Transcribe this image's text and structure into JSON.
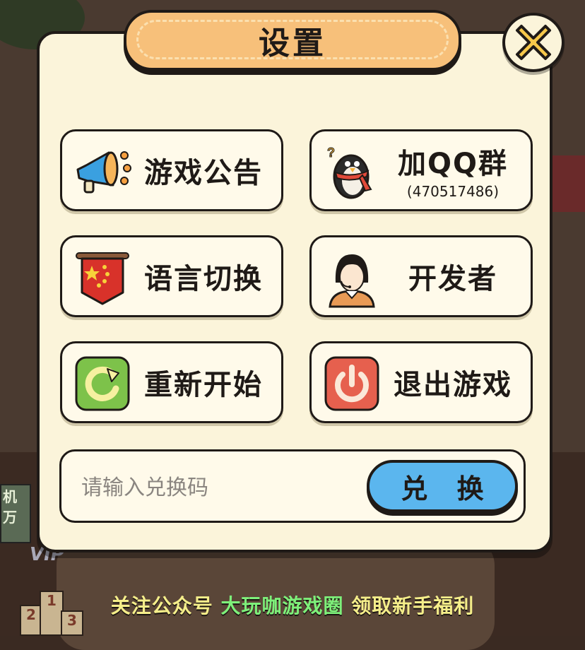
{
  "dialog": {
    "title": "设置",
    "close_icon": "close-x-icon"
  },
  "options": [
    {
      "key": "announcement",
      "label": "游戏公告",
      "icon": "megaphone-icon"
    },
    {
      "key": "qq_group",
      "label": "加QQ群",
      "sub": "(470517486)",
      "icon": "penguin-icon"
    },
    {
      "key": "language",
      "label": "语言切换",
      "icon": "banner-flag-icon"
    },
    {
      "key": "developer",
      "label": "开发者",
      "icon": "developer-avatar-icon"
    },
    {
      "key": "restart",
      "label": "重新开始",
      "icon": "restart-arrow-icon"
    },
    {
      "key": "quit",
      "label": "退出游戏",
      "icon": "power-icon"
    }
  ],
  "redeem": {
    "placeholder": "请输入兑换码",
    "value": "",
    "button_label": "兑 换"
  },
  "promo": {
    "part1": "关注公众号 ",
    "highlight": "大玩咖游戏圈",
    "part2": " 领取新手福利"
  },
  "background": {
    "side_label_1": "机",
    "side_label_2": "万",
    "vip_label": "VIP",
    "podium": [
      "2",
      "1",
      "3"
    ]
  },
  "colors": {
    "panel_bg": "#fbf4da",
    "title_tab": "#f7c07a",
    "redeem_button": "#5bb6ee",
    "close_x": "#f7c84a",
    "promo_text": "#f5ee8a",
    "promo_highlight": "#7ef07a"
  }
}
